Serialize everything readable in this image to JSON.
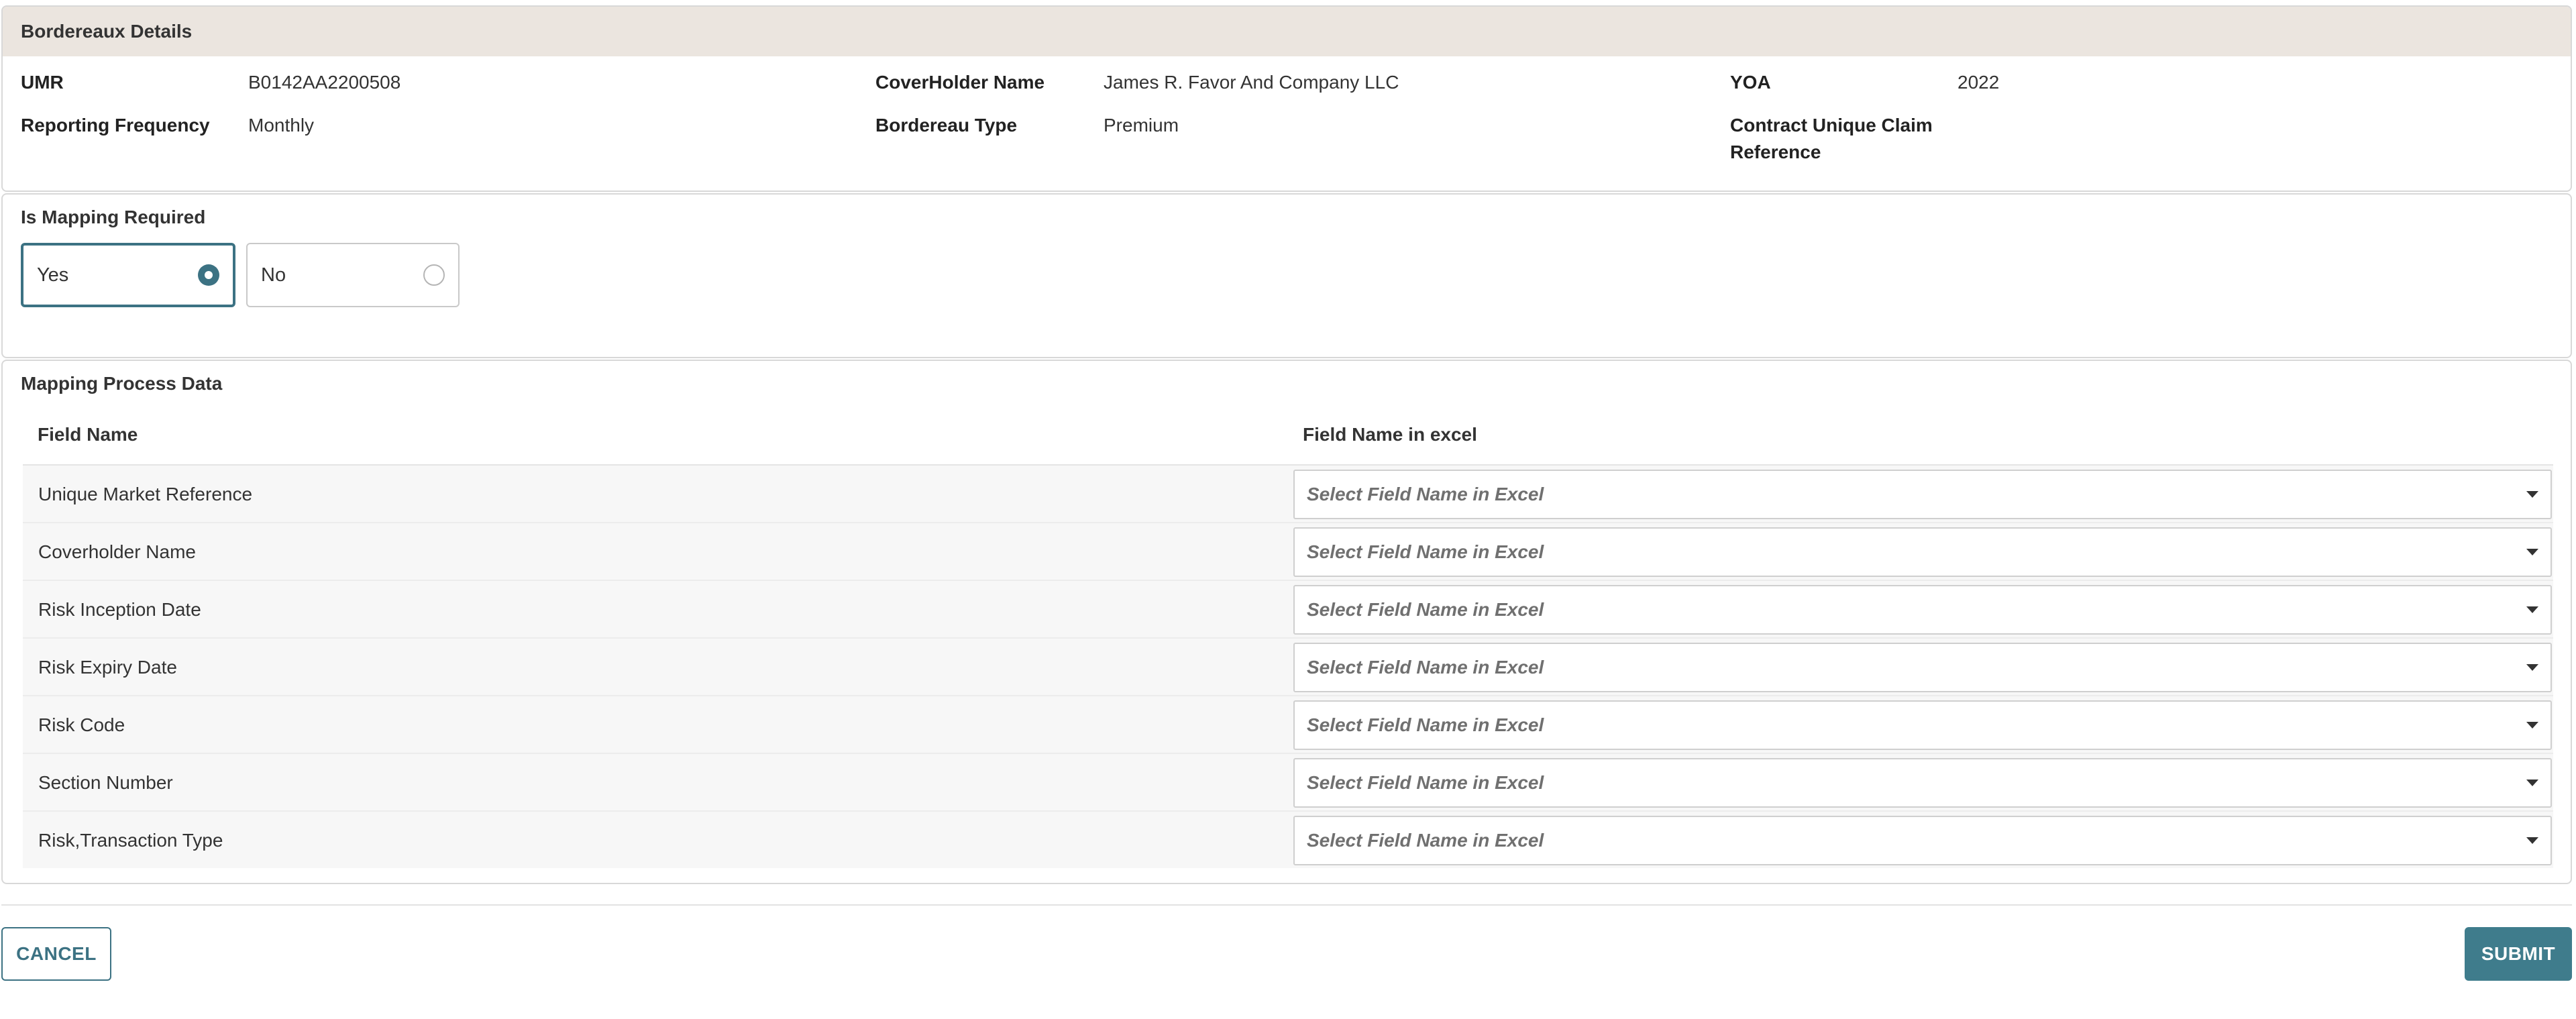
{
  "bordereaux_details": {
    "title": "Bordereaux Details",
    "fields": {
      "umr": {
        "label": "UMR",
        "value": "B0142AA2200508"
      },
      "coverholder_name": {
        "label": "CoverHolder Name",
        "value": "James R. Favor And Company LLC"
      },
      "yoa": {
        "label": "YOA",
        "value": "2022"
      },
      "reporting_frequency": {
        "label": "Reporting Frequency",
        "value": "Monthly"
      },
      "bordereau_type": {
        "label": "Bordereau Type",
        "value": "Premium"
      },
      "contract_unique_claim_reference": {
        "label_line1": "Contract Unique Claim",
        "label_line2": "Reference",
        "value": ""
      }
    }
  },
  "mapping_required": {
    "title": "Is Mapping Required",
    "options": [
      {
        "label": "Yes",
        "selected": true
      },
      {
        "label": "No",
        "selected": false
      }
    ]
  },
  "mapping_process": {
    "title": "Mapping Process Data",
    "columns": {
      "field_name": "Field Name",
      "field_name_in_excel": "Field Name in excel"
    },
    "rows": [
      {
        "field": "Unique Market Reference",
        "placeholder": "Select Field Name in Excel"
      },
      {
        "field": "Coverholder Name",
        "placeholder": "Select Field Name in Excel"
      },
      {
        "field": "Risk Inception Date",
        "placeholder": "Select Field Name in Excel"
      },
      {
        "field": "Risk Expiry Date",
        "placeholder": "Select Field Name in Excel"
      },
      {
        "field": "Risk Code",
        "placeholder": "Select Field Name in Excel"
      },
      {
        "field": "Section Number",
        "placeholder": "Select Field Name in Excel"
      },
      {
        "field": "Risk,Transaction Type",
        "placeholder": "Select Field Name in Excel"
      }
    ]
  },
  "footer": {
    "cancel_label": "CANCEL",
    "submit_label": "SUBMIT"
  },
  "colors": {
    "accent": "#3c7283",
    "submit_bg": "#3f7c8c",
    "header_bg": "#ebe5df"
  }
}
